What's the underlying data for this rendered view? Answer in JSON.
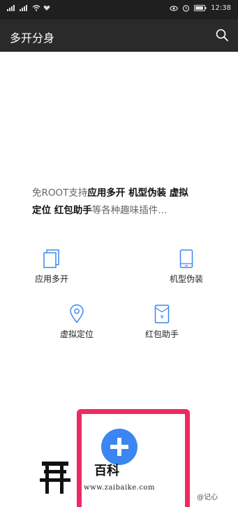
{
  "status_bar": {
    "time": "12:38"
  },
  "app_bar": {
    "title": "多开分身"
  },
  "intro": {
    "prefix": "免ROOT支持",
    "bold1": "应用多开 机型伪装 虚拟",
    "bold2": "定位 红包助手",
    "suffix": "等各种趣味插件..."
  },
  "features": [
    {
      "label": "应用多开",
      "icon": "copy-icon"
    },
    {
      "label": "机型伪装",
      "icon": "phone-icon"
    },
    {
      "label": "虚拟定位",
      "icon": "location-icon"
    },
    {
      "label": "红包助手",
      "icon": "red-envelope-icon"
    }
  ],
  "watermark": {
    "logo_text": "百科",
    "url": "www.zaibaike.com",
    "corner_text": "@记心"
  },
  "colors": {
    "accent_blue": "#3b86f0",
    "frame_pink": "#ee2a62"
  }
}
